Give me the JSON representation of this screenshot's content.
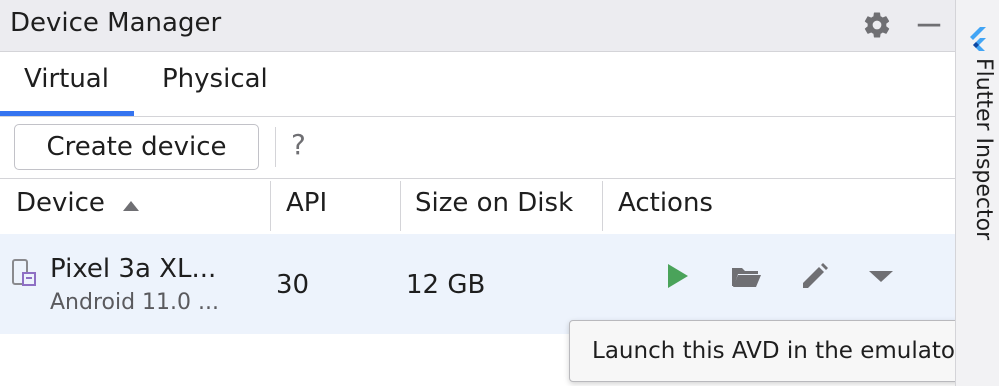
{
  "header": {
    "title": "Device Manager"
  },
  "icons": {
    "settings": "gear-icon",
    "minimize": "minimize-icon"
  },
  "tabs": [
    {
      "label": "Virtual",
      "selected": true
    },
    {
      "label": "Physical",
      "selected": false
    }
  ],
  "toolbar": {
    "create_label": "Create device",
    "help_label": "?"
  },
  "table": {
    "columns": [
      "Device",
      "API",
      "Size on Disk",
      "Actions"
    ],
    "sort": {
      "column": "Device",
      "direction": "ascending"
    },
    "rows": [
      {
        "name": "Pixel 3a XL...",
        "subtitle": "Android 11.0 ...",
        "api": "30",
        "size": "12 GB",
        "actions": [
          "play-icon",
          "folder-icon",
          "edit-icon",
          "chevron-down-icon"
        ]
      }
    ]
  },
  "tooltip": {
    "text": "Launch this AVD in the emulator"
  },
  "sidebar": {
    "label": "Flutter Inspector"
  },
  "colors": {
    "accent": "#3574f0",
    "play_green": "#4aa35a",
    "icon_gray": "#6f6f73",
    "row_selected": "#edf3fc",
    "flutter_blue": "#42a5f5"
  }
}
